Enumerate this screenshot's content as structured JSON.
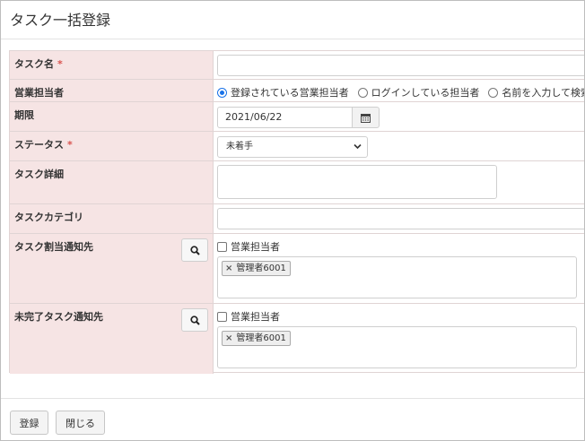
{
  "window": {
    "title": "タスク一括登録"
  },
  "form": {
    "task_name": {
      "label": "タスク名",
      "required_mark": "*",
      "value": ""
    },
    "sales_rep": {
      "label": "営業担当者",
      "options": [
        {
          "label": "登録されている営業担当者",
          "checked": true
        },
        {
          "label": "ログインしている担当者",
          "checked": false
        },
        {
          "label": "名前を入力して検索",
          "checked": false
        }
      ]
    },
    "due_date": {
      "label": "期限",
      "value": "2021/06/22",
      "icon": "calendar-icon"
    },
    "status": {
      "label": "ステータス",
      "required_mark": "*",
      "selected": "未着手"
    },
    "task_detail": {
      "label": "タスク詳細",
      "value": ""
    },
    "task_category": {
      "label": "タスクカテゴリ",
      "value": ""
    },
    "assign_notify": {
      "label": "タスク割当通知先",
      "checkbox_label": "営業担当者",
      "tags": [
        {
          "remove": "×",
          "label": "管理者6001"
        }
      ]
    },
    "incomplete_notify": {
      "label": "未完了タスク通知先",
      "checkbox_label": "営業担当者",
      "tags": [
        {
          "remove": "×",
          "label": "管理者6001"
        }
      ]
    }
  },
  "footer": {
    "register_label": "登録",
    "close_label": "閉じる"
  },
  "colors": {
    "label_bg": "#f6e4e4",
    "required": "#d9534f",
    "radio_accent": "#1a73e8"
  }
}
